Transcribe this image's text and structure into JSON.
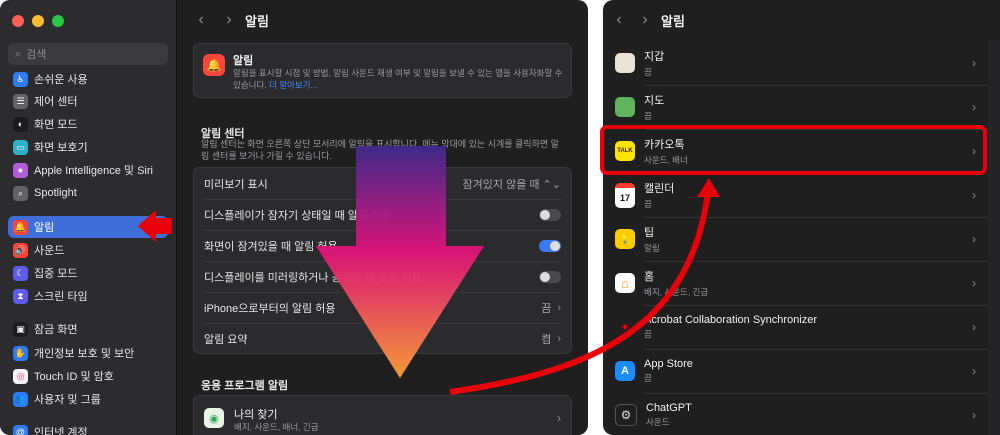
{
  "colors": {
    "accent": "#3f6ed8",
    "highlight": "#e8000b",
    "toggle_on": "#3a7bf4"
  },
  "sidebar": {
    "search_placeholder": "검색",
    "items": [
      {
        "label": "손쉬운 사용",
        "icon": "accessibility-icon",
        "color": "#2f7bf5",
        "glyph": "♿"
      },
      {
        "label": "제어 센터",
        "icon": "control-center-icon",
        "color": "#636366",
        "glyph": "☰"
      },
      {
        "label": "화면 모드",
        "icon": "appearance-icon",
        "color": "#1c1c1e",
        "glyph": "◐"
      },
      {
        "label": "화면 보호기",
        "icon": "screensaver-icon",
        "color": "#30b0c7",
        "glyph": "▭"
      },
      {
        "label": "Apple Intelligence 및 Siri",
        "icon": "siri-icon",
        "color": "#b45bdc",
        "glyph": "●"
      },
      {
        "label": "Spotlight",
        "icon": "spotlight-icon",
        "color": "#636366",
        "glyph": "⌕"
      },
      {
        "label": "알림",
        "icon": "bell-icon",
        "color": "#ff453a",
        "glyph": "🔔"
      },
      {
        "label": "사운드",
        "icon": "sound-icon",
        "color": "#ff453a",
        "glyph": "🔊"
      },
      {
        "label": "집중 모드",
        "icon": "moon-icon",
        "color": "#5e5ce6",
        "glyph": "☾"
      },
      {
        "label": "스크린 타임",
        "icon": "hourglass-icon",
        "color": "#5e5ce6",
        "glyph": "⧗"
      },
      {
        "label": "잠금 화면",
        "icon": "lock-screen-icon",
        "color": "#1c1c1e",
        "glyph": "▣"
      },
      {
        "label": "개인정보 보호 및 보안",
        "icon": "hand-icon",
        "color": "#2f7bf5",
        "glyph": "✋"
      },
      {
        "label": "Touch ID 및 암호",
        "icon": "fingerprint-icon",
        "color": "#f2f2f7",
        "glyph": "◎"
      },
      {
        "label": "사용자 및 그룹",
        "icon": "users-icon",
        "color": "#2f7bf5",
        "glyph": "👥"
      },
      {
        "label": "인터넷 계정",
        "icon": "at-icon",
        "color": "#2f7bf5",
        "glyph": "@"
      }
    ]
  },
  "main": {
    "title": "알림",
    "intro": {
      "title": "알림",
      "text": "알림을 표시할 시점 및 방법, 알림 사운드 재생 여부 및 알림을 보낼 수 있는 앱을 사용자화할 수 있습니다.",
      "link": "더 알아보기..."
    },
    "center": {
      "title": "알림 센터",
      "desc": "알림 센터는 화면 오른쪽 상단 모서리에 알림을 표시합니다. 메뉴 막대에 있는 시계를 클릭하면 알림 센터를 보거나 가릴 수 있습니다.",
      "rows": [
        {
          "label": "미리보기 표시",
          "value": "잠겨있지 않을 때 ⌃⌄",
          "kind": "select"
        },
        {
          "label": "디스플레이가 잠자기 상태일 때 알림 허용",
          "kind": "toggle",
          "on": false
        },
        {
          "label": "화면이 잠겨있을 때 알림 허용",
          "kind": "toggle",
          "on": true
        },
        {
          "label": "디스플레이를 미러링하거나 공유할 때 알림 허용",
          "kind": "toggle",
          "on": false
        },
        {
          "label": "iPhone으로부터의 알림 허용",
          "value": "끔",
          "kind": "nav"
        },
        {
          "label": "알림 요약",
          "value": "켬",
          "kind": "nav"
        }
      ]
    },
    "apps": {
      "title": "응용 프로그램 알림",
      "first": {
        "name": "나의 찾기",
        "sub": "배지, 사운드, 배너, 긴급"
      }
    }
  },
  "right": {
    "title": "알림",
    "apps": [
      {
        "name": "지갑",
        "sub": "끔",
        "icon": "wallet-icon",
        "color": "#e9e4d4"
      },
      {
        "name": "지도",
        "sub": "끔",
        "icon": "maps-icon",
        "color": "#5fb35c"
      },
      {
        "name": "카카오톡",
        "sub": "사운드, 배너",
        "icon": "kakaotalk-icon",
        "color": "#fee500",
        "glyph": "TALK"
      },
      {
        "name": "캘린더",
        "sub": "끔",
        "icon": "calendar-icon",
        "color": "#ffffff",
        "glyph": "17"
      },
      {
        "name": "팁",
        "sub": "알림",
        "icon": "tips-icon",
        "color": "#ffcc00",
        "glyph": "💡"
      },
      {
        "name": "홈",
        "sub": "배지, 사운드, 긴급",
        "icon": "home-icon",
        "color": "#ffffff",
        "glyph": "⌂"
      },
      {
        "name": "Acrobat Collaboration Synchronizer",
        "sub": "끔",
        "icon": "acrobat-icon",
        "color": "#1f1f1f",
        "glyph": "✦"
      },
      {
        "name": "App Store",
        "sub": "끔",
        "icon": "app-store-icon",
        "color": "#1a8cff",
        "glyph": "A"
      },
      {
        "name": "ChatGPT",
        "sub": "사운드",
        "icon": "chatgpt-icon",
        "color": "#1f1f1f",
        "glyph": "⚙"
      }
    ]
  }
}
